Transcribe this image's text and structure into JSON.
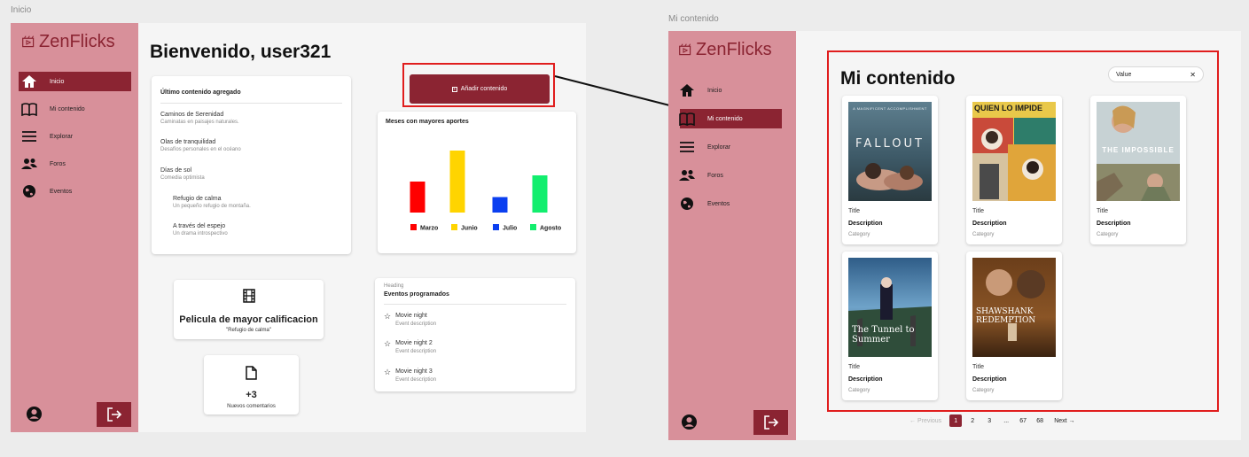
{
  "left": {
    "frame_label": "Inicio",
    "logo": "ZenFlicks",
    "heading": "Bienvenido, user321",
    "add_button": "Añadir contenido",
    "nav": [
      {
        "label": "Inicio",
        "icon": "home-icon"
      },
      {
        "label": "Mi contenido",
        "icon": "book-icon"
      },
      {
        "label": "Explorar",
        "icon": "menu-icon"
      },
      {
        "label": "Foros",
        "icon": "users-icon"
      },
      {
        "label": "Eventos",
        "icon": "globe-icon"
      }
    ],
    "latest": {
      "title": "Último contenido agregado",
      "items": [
        {
          "title": "Caminos de Serenidad",
          "desc": "Caminatas en paisajes naturales."
        },
        {
          "title": "Olas de tranquilidad",
          "desc": "Desafíos personales en el océano"
        },
        {
          "title": "Días de sol",
          "desc": "Comedia optimista"
        },
        {
          "title": "Refugio de calma",
          "desc": "Un pequeño refugio de montaña."
        },
        {
          "title": "A través del espejo",
          "desc": "Un drama introspectivo"
        }
      ]
    },
    "best_movie": {
      "title": "Pelicula de mayor calificacion",
      "subtitle": "\"Refugio de calma\""
    },
    "comments": {
      "count": "+3",
      "label": "Nuevos comentarios"
    },
    "events": {
      "small": "Heading",
      "title": "Eventos programados",
      "items": [
        {
          "title": "Movie night",
          "desc": "Event description"
        },
        {
          "title": "Movie night 2",
          "desc": "Event description"
        },
        {
          "title": "Movie night 3",
          "desc": "Event description"
        }
      ]
    }
  },
  "chart_data": {
    "type": "bar",
    "title": "Meses con mayores aportes",
    "categories": [
      "Marzo",
      "Junio",
      "Julio",
      "Agosto"
    ],
    "values": [
      2,
      4,
      1,
      2.4
    ],
    "colors": [
      "#ff0000",
      "#ffd400",
      "#0b3ff0",
      "#12ee6e"
    ],
    "ylim": [
      0,
      4
    ],
    "legend": "bottom",
    "grid": false
  },
  "right": {
    "frame_label": "Mi contenido",
    "logo": "ZenFlicks",
    "heading": "Mi contenido",
    "search_value": "Value",
    "nav": [
      {
        "label": "Inicio",
        "icon": "home-icon"
      },
      {
        "label": "Mi contenido",
        "icon": "book-icon"
      },
      {
        "label": "Explorar",
        "icon": "menu-icon"
      },
      {
        "label": "Foros",
        "icon": "users-icon"
      },
      {
        "label": "Eventos",
        "icon": "globe-icon"
      }
    ],
    "cards": [
      {
        "poster_title": "FALLOUT",
        "poster_top": "A MAGNIFICENT ACCOMPLISHMENT",
        "poster_bg": "#4a6677",
        "title": "Title",
        "desc": "Description",
        "cat": "Category"
      },
      {
        "poster_title": "QUIEN LO IMPIDE",
        "poster_top": "",
        "poster_bg": "#c94a3a",
        "title": "Title",
        "desc": "Description",
        "cat": "Category"
      },
      {
        "poster_title": "THE IMPOSSIBLE",
        "poster_top": "",
        "poster_bg": "#a7b8bf",
        "title": "Title",
        "desc": "Description",
        "cat": "Category"
      },
      {
        "poster_title": "The Tunnel to Summer",
        "poster_top": "",
        "poster_bg": "#5d8bb0",
        "title": "Title",
        "desc": "Description",
        "cat": "Category"
      },
      {
        "poster_title": "SHAWSHANK REDEMPTION",
        "poster_top": "",
        "poster_bg": "#7a4a22",
        "title": "Title",
        "desc": "Description",
        "cat": "Category"
      }
    ],
    "pagination": {
      "prev": "← Previous",
      "pages": [
        "1",
        "2",
        "3",
        "...",
        "67",
        "68"
      ],
      "next": "Next →"
    }
  }
}
